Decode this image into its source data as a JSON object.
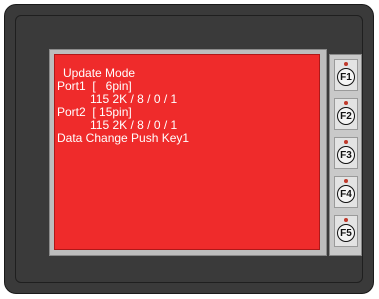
{
  "screen": {
    "lines": [
      "Update Mode",
      "Port1  [   6pin]",
      "115 2K / 8 / 0 / 1",
      "Port2  [ 15pin]",
      "115 2K / 8 / 0 / 1",
      "Data Change Push Key1"
    ]
  },
  "function_keys": [
    "F1",
    "F2",
    "F3",
    "F4",
    "F5"
  ],
  "colors": {
    "screen_bg": "#ef2b2b",
    "bezel": "#3a3a3a",
    "led": "#c0392b"
  }
}
